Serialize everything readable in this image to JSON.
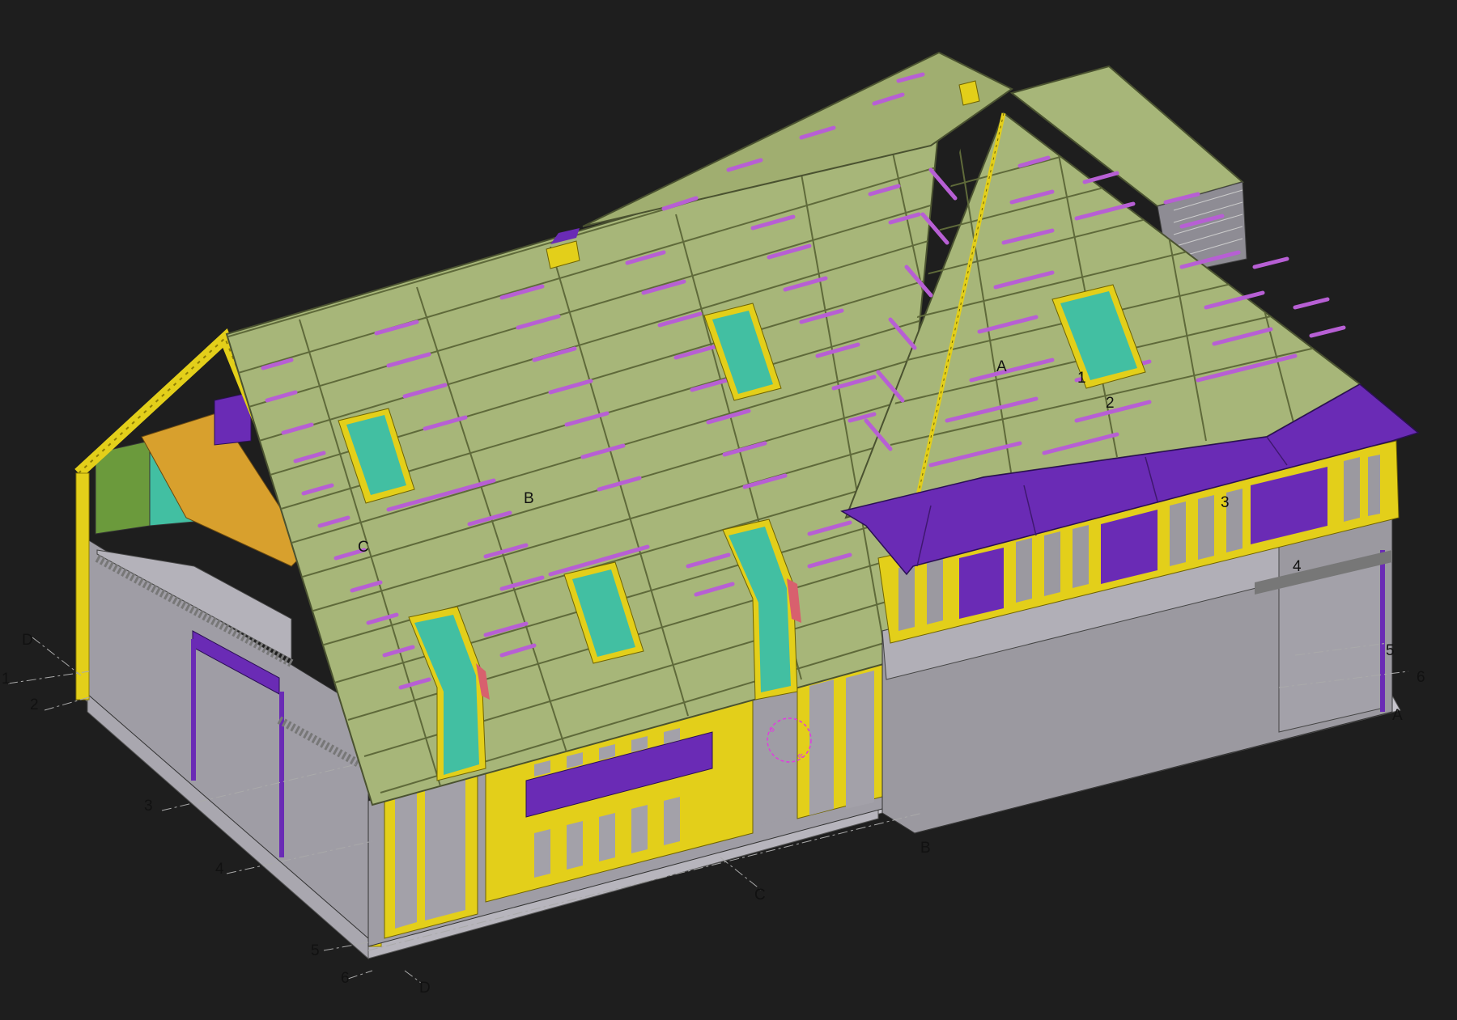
{
  "viewport": {
    "background_color": "#1e1e1e",
    "element_colors": {
      "roof_panel": "#a7b679",
      "roof_panel_line": "#5f6a3a",
      "timber_frame": "#e3cf1a",
      "membrane": "#6a2bb5",
      "window_glass": "#42bfa2",
      "wall_surface": "#9b99a0",
      "slab": "#c0bec6",
      "insulation": "#d8a02d",
      "green_board": "#6b9a3c",
      "pink_flashing": "#d8606e",
      "marker": "#e13be0"
    },
    "grid_labels": {
      "left_side": [
        "D",
        "1",
        "2",
        "3",
        "4",
        "5",
        "6",
        "D"
      ],
      "front_side": [
        "C",
        "B"
      ],
      "right_side": [
        "5",
        "6",
        "A"
      ]
    },
    "roof_labels": [
      "A",
      "1",
      "2",
      "B",
      "C",
      "3",
      "4"
    ],
    "cursor_marker": "rotate-orbit-icon"
  }
}
